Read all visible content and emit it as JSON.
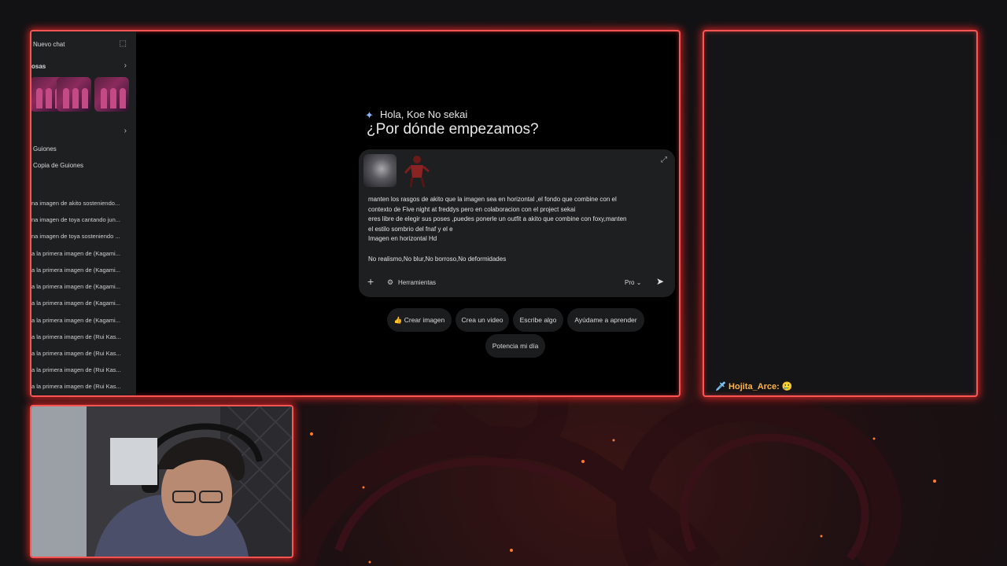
{
  "sidebar": {
    "new_chat": "Nuevo chat",
    "section_label": "osas",
    "gems": [
      "Guiones",
      "Copia de Guiones"
    ],
    "history": [
      "na imagen de akito sosteniendo...",
      "na imagen de toya cantando jun...",
      "na imagen de toya sosteniendo ...",
      "a la primera imagen de (Kagami...",
      "a la primera imagen de (Kagami...",
      "a la primera imagen de (Kagami...",
      "a la primera imagen de (Kagami...",
      "a la primera imagen de (Kagami...",
      "a la primera imagen de (Rui Kas...",
      "a la primera imagen de (Rui Kas...",
      "a la primera imagen de (Rui Kas...",
      "a la primera imagen de (Rui Kas..."
    ]
  },
  "main": {
    "greeting": "Hola, Koe No sekai",
    "headline": "¿Por dónde empezamos?",
    "prompt_lines": [
      "manten los rasgos de akito que la imagen sea en horizontal ,el fondo que combine con el",
      "contexto de Five night at freddys pero en colaboracion con el project sekai",
      "eres libre de elegir sus poses ,puedes ponerle un outfit a akito que combine con foxy,manten",
      "el estilo sombrio del fnaf y el e",
      "Imagen en horizontal Hd",
      "",
      "No realismo,No blur,No borroso,No deformidades"
    ],
    "tools_label": "Herramientas",
    "model_label": "Pro",
    "chips": [
      "Crear imagen",
      "Crea un video",
      "Escribe algo",
      "Ayúdame a aprender",
      "Potencia mi día"
    ],
    "chip_icon": "👍"
  },
  "chat": {
    "user": "Hojita_Arce:",
    "message_emoji": "🥲"
  },
  "colors": {
    "frame_border": "#ff5555",
    "background": "#141416",
    "composer": "#1e1f20"
  },
  "icons": [
    "new-chat-icon",
    "chevron-right-icon",
    "gemini-sparkle-icon",
    "expand-icon",
    "plus-icon",
    "tools-icon",
    "chevron-down-icon",
    "send-icon",
    "sword-icon"
  ]
}
